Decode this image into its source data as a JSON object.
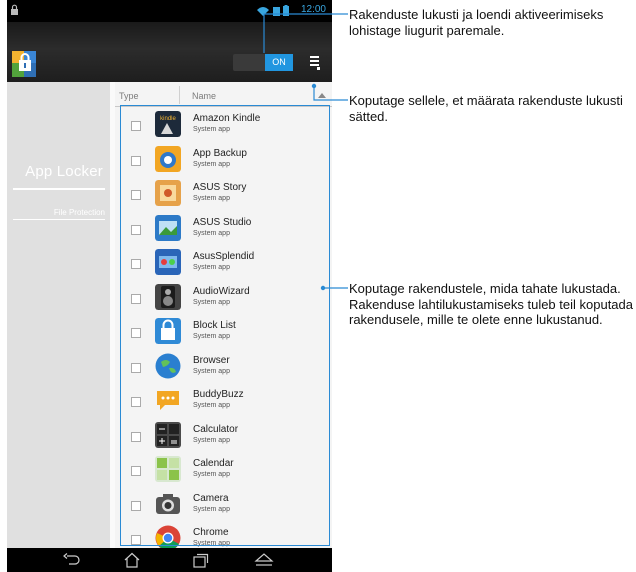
{
  "status_bar": {
    "time": "12:00",
    "lock_icon": "lock-icon",
    "system_icons": [
      "wifi-icon",
      "sd-card-icon",
      "battery-icon"
    ]
  },
  "action_bar": {
    "app_icon": "app-locker-icon",
    "toggle_label": "ON",
    "overflow_icon": "overflow-menu-icon"
  },
  "sidebar": {
    "items": [
      {
        "label": "App Locker",
        "selected": true
      },
      {
        "label": "File Protection",
        "selected": false
      }
    ]
  },
  "list_header": {
    "type_label": "Type",
    "name_label": "Name",
    "sort_icon": "sort-triangle-icon"
  },
  "apps": [
    {
      "name": "Amazon Kindle",
      "subtitle": "System app",
      "checked": false,
      "icon": "kindle-icon"
    },
    {
      "name": "App Backup",
      "subtitle": "System app",
      "checked": false,
      "icon": "app-backup-icon"
    },
    {
      "name": "ASUS Story",
      "subtitle": "System app",
      "checked": false,
      "icon": "asus-story-icon"
    },
    {
      "name": "ASUS Studio",
      "subtitle": "System app",
      "checked": false,
      "icon": "asus-studio-icon"
    },
    {
      "name": "AsusSplendid",
      "subtitle": "System app",
      "checked": false,
      "icon": "asus-splendid-icon"
    },
    {
      "name": "AudioWizard",
      "subtitle": "System app",
      "checked": false,
      "icon": "audio-wizard-icon"
    },
    {
      "name": "Block List",
      "subtitle": "System app",
      "checked": false,
      "icon": "block-list-icon"
    },
    {
      "name": "Browser",
      "subtitle": "System app",
      "checked": false,
      "icon": "browser-globe-icon"
    },
    {
      "name": "BuddyBuzz",
      "subtitle": "System app",
      "checked": false,
      "icon": "buddybuzz-icon"
    },
    {
      "name": "Calculator",
      "subtitle": "System app",
      "checked": false,
      "icon": "calculator-icon"
    },
    {
      "name": "Calendar",
      "subtitle": "System app",
      "checked": false,
      "icon": "calendar-icon"
    },
    {
      "name": "Camera",
      "subtitle": "System app",
      "checked": false,
      "icon": "camera-icon"
    },
    {
      "name": "Chrome",
      "subtitle": "System app",
      "checked": false,
      "icon": "chrome-icon"
    }
  ],
  "nav_bar": [
    "back-icon",
    "home-icon",
    "recent-apps-icon",
    "menu-up-icon"
  ],
  "callouts": {
    "toggle": "Rakenduste lukusti ja loendi aktiveerimiseks lohistage liugurit paremale.",
    "settings": "Koputage sellele, et määrata rakenduste lukusti sätted.",
    "apps": "Koputage rakendustele, mida tahate lukustada. Rakenduse lahtilukustamiseks tuleb teil koputada rakendusele, mille te olete enne lukustanud."
  },
  "colors": {
    "accent_blue": "#2196e0",
    "callout_line": "#2a8ad4",
    "sidebar_bg": "#e0e0e0"
  }
}
